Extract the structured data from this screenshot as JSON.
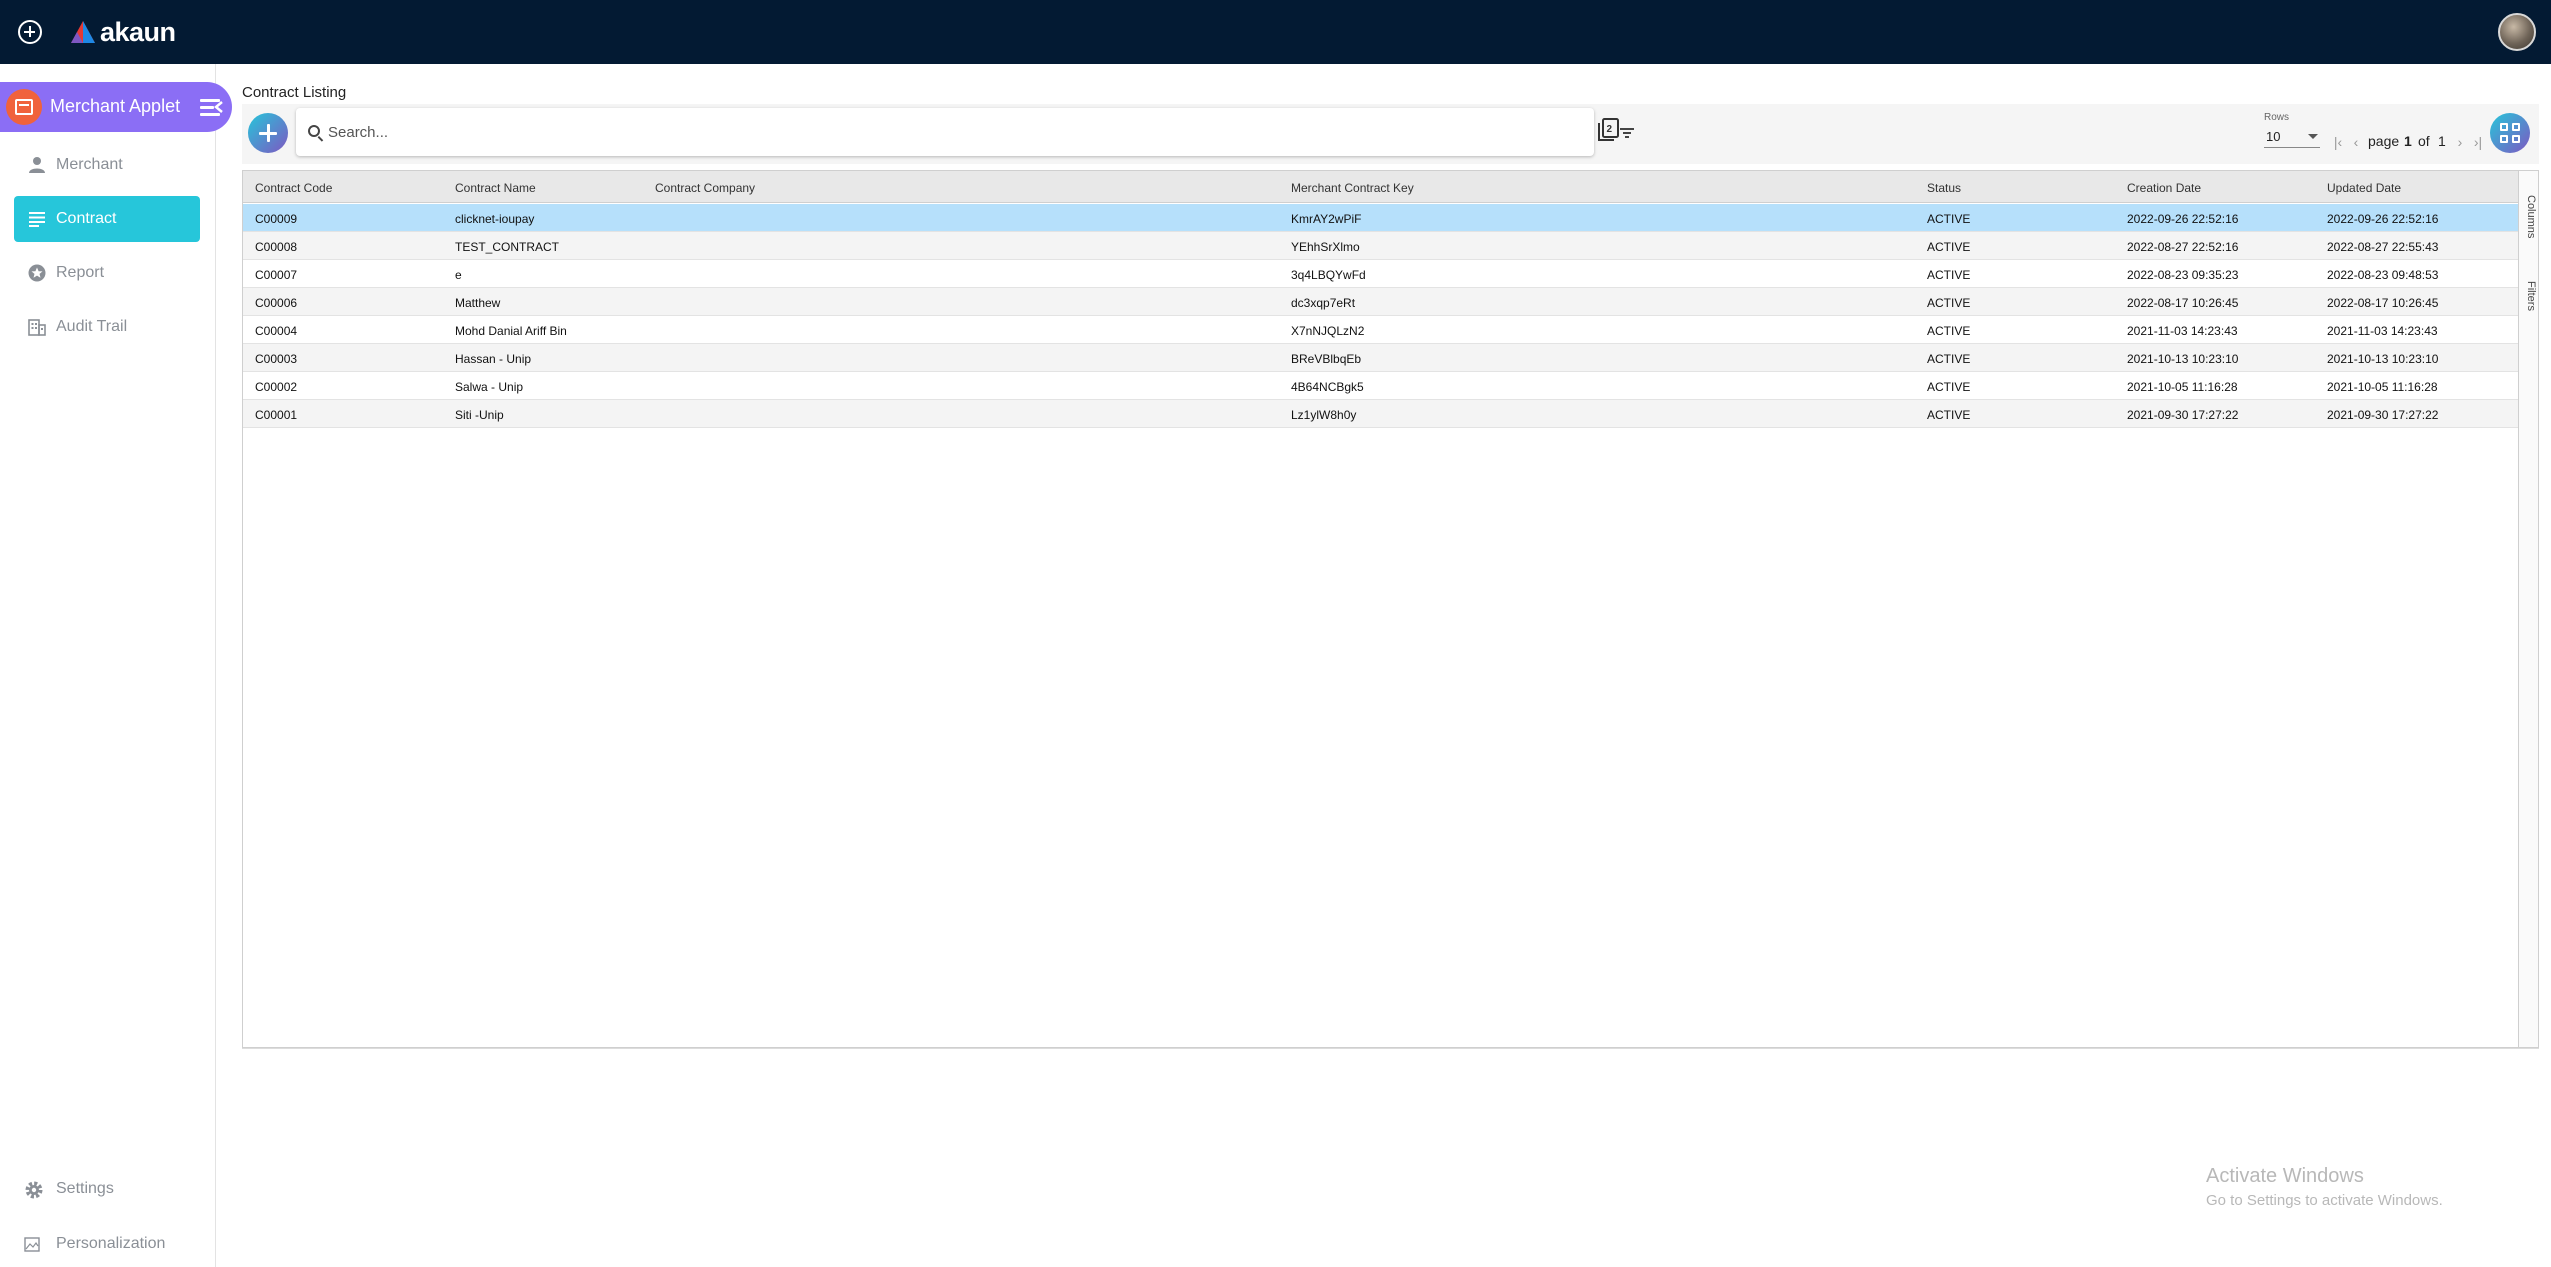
{
  "app": {
    "name": "akaun"
  },
  "sidebar": {
    "applet_title": "Merchant Applet",
    "items": [
      {
        "label": "Merchant",
        "icon": "person-icon",
        "active": false
      },
      {
        "label": "Contract",
        "icon": "list-icon",
        "active": true
      },
      {
        "label": "Report",
        "icon": "star-icon",
        "active": false
      },
      {
        "label": "Audit Trail",
        "icon": "building-icon",
        "active": false
      }
    ],
    "bottom": [
      {
        "label": "Settings",
        "icon": "gear-icon"
      },
      {
        "label": "Personalization",
        "icon": "broken-image-icon"
      }
    ]
  },
  "main": {
    "title": "Contract Listing",
    "search_placeholder": "Search...",
    "rows_label": "Rows",
    "rows_value": "10",
    "pager": {
      "page_word": "page",
      "page": "1",
      "of_word": "of",
      "total": "1"
    }
  },
  "grid": {
    "columns": [
      "Contract Code",
      "Contract Name",
      "Contract Company",
      "Merchant Contract Key",
      "Status",
      "Creation Date",
      "Updated Date"
    ],
    "rows": [
      {
        "code": "C00009",
        "name": "clicknet-ioupay",
        "company": "",
        "key": "KmrAY2wPiF",
        "status": "ACTIVE",
        "created": "2022-09-26 22:52:16",
        "updated": "2022-09-26 22:52:16"
      },
      {
        "code": "C00008",
        "name": "TEST_CONTRACT",
        "company": "",
        "key": "YEhhSrXlmo",
        "status": "ACTIVE",
        "created": "2022-08-27 22:52:16",
        "updated": "2022-08-27 22:55:43"
      },
      {
        "code": "C00007",
        "name": "e",
        "company": "",
        "key": "3q4LBQYwFd",
        "status": "ACTIVE",
        "created": "2022-08-23 09:35:23",
        "updated": "2022-08-23 09:48:53"
      },
      {
        "code": "C00006",
        "name": "Matthew",
        "company": "",
        "key": "dc3xqp7eRt",
        "status": "ACTIVE",
        "created": "2022-08-17 10:26:45",
        "updated": "2022-08-17 10:26:45"
      },
      {
        "code": "C00004",
        "name": "Mohd Danial Ariff Bin",
        "company": "",
        "key": "X7nNJQLzN2",
        "status": "ACTIVE",
        "created": "2021-11-03 14:23:43",
        "updated": "2021-11-03 14:23:43"
      },
      {
        "code": "C00003",
        "name": "Hassan - Unip",
        "company": "",
        "key": "BReVBlbqEb",
        "status": "ACTIVE",
        "created": "2021-10-13 10:23:10",
        "updated": "2021-10-13 10:23:10"
      },
      {
        "code": "C00002",
        "name": "Salwa - Unip",
        "company": "",
        "key": "4B64NCBgk5",
        "status": "ACTIVE",
        "created": "2021-10-05 11:16:28",
        "updated": "2021-10-05 11:16:28"
      },
      {
        "code": "C00001",
        "name": "Siti -Unip",
        "company": "",
        "key": "Lz1ylW8h0y",
        "status": "ACTIVE",
        "created": "2021-09-30 17:27:22",
        "updated": "2021-09-30 17:27:22"
      }
    ],
    "side_tabs": [
      "Columns",
      "Filters"
    ]
  },
  "watermark": {
    "title": "Activate Windows",
    "subtitle": "Go to Settings to activate Windows."
  },
  "colors": {
    "topbar": "#031a33",
    "applet": "#8b6ef5",
    "active_nav": "#26c6da",
    "selected_row": "#b6e0fb"
  }
}
